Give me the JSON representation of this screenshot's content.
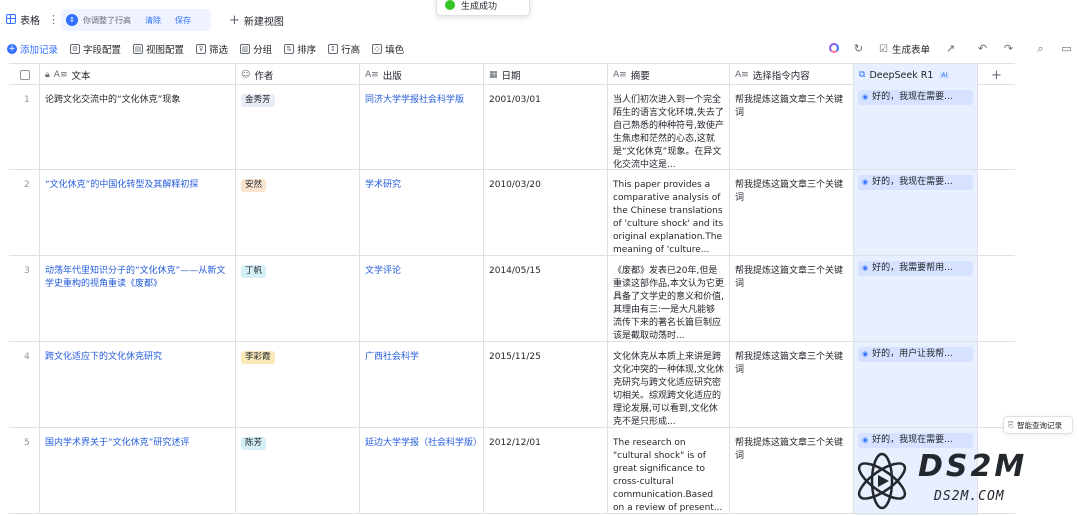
{
  "view_tab": {
    "label": "表格"
  },
  "notice": {
    "text": "你调整了行高",
    "clear": "清除",
    "save": "保存"
  },
  "new_view": "新建视图",
  "toast": "生成成功",
  "toolbar": {
    "add": "添加记录",
    "field_config": "字段配置",
    "view_config": "视图配置",
    "filter": "筛选",
    "group": "分组",
    "sort": "排序",
    "row_height": "行高",
    "fill_color": "填色",
    "generate_form": "生成表单"
  },
  "columns": [
    {
      "key": "text",
      "icon": "A≡",
      "label": "文本"
    },
    {
      "key": "author",
      "icon": "☺",
      "label": "作者"
    },
    {
      "key": "publisher",
      "icon": "A≡",
      "label": "出版"
    },
    {
      "key": "date",
      "icon": "▦",
      "label": "日期"
    },
    {
      "key": "summary",
      "icon": "A≡",
      "label": "摘要"
    },
    {
      "key": "prompt",
      "icon": "A≡",
      "label": "选择指令内容"
    },
    {
      "key": "deepseek",
      "icon": "⧉",
      "label": "DeepSeek R1",
      "badge": "AI"
    }
  ],
  "rows": [
    {
      "num": "1",
      "text": "论跨文化交流中的“文化休克”现象",
      "text_link": false,
      "author": "金秀芳",
      "author_color": "#e8edf5",
      "publisher": "同济大学学报社会科学版",
      "date": "2001/03/01",
      "summary": "当人们初次进入到一个完全陌生的语言文化环境,失去了自己熟悉的种种符号,致使产生焦虑和茫然的心态,这就是“文化休克”现象。在异文化交流中这是...",
      "prompt": "帮我提炼这篇文章三个关键词",
      "deepseek": "好的，我现在需要..."
    },
    {
      "num": "2",
      "text": "“文化休克”的中国化转型及其解释初探",
      "text_link": true,
      "author": "安然",
      "author_color": "#fbe4cf",
      "publisher": "学术研究",
      "date": "2010/03/20",
      "summary": "This paper provides a comparative analysis of the Chinese translations of 'culture shock' and its original explanation.The meaning of 'culture...",
      "prompt": "帮我提炼这篇文章三个关键词",
      "deepseek": "好的，我现在需要..."
    },
    {
      "num": "3",
      "text": "动荡年代里知识分子的“文化休克”——从新文学史重构的视角重读《废都》",
      "text_link": true,
      "author": "丁帆",
      "author_color": "#d5eff6",
      "publisher": "文学评论",
      "date": "2014/05/15",
      "summary": "《废都》发表已20年,但是重读这部作品,本文认为它更具备了文学史的意义和价值,其理由有三:一是大凡能够流传下来的著名长篇巨制应该是截取动荡时...",
      "prompt": "帮我提炼这篇文章三个关键词",
      "deepseek": "好的，我需要帮用..."
    },
    {
      "num": "4",
      "text": "跨文化适应下的文化休克研究",
      "text_link": true,
      "author": "李彩霞",
      "author_color": "#fae8b8",
      "publisher": "广西社会科学",
      "date": "2015/11/25",
      "summary": "文化休克从本质上来讲是跨文化冲突的一种体现,文化休克研究与跨文化适应研究密切相关。综观跨文化适应的理论发展,可以看到,文化休克不是只形成...",
      "prompt": "帮我提炼这篇文章三个关键词",
      "deepseek": "好的，用户让我帮..."
    },
    {
      "num": "5",
      "text": "国内学术界关于“文化休克”研究述评",
      "text_link": true,
      "author": "陈芳",
      "author_color": "#d5eff6",
      "publisher": "延边大学学报（社会科学版）",
      "date": "2012/12/01",
      "summary": "The research on \"cultural shock\" is of great significance to cross-cultural communication.Based on a review of present...",
      "prompt": "帮我提炼这篇文章三个关键词",
      "deepseek": "好的，我现在需要..."
    }
  ],
  "side": {
    "smart_query": "智能查询记录"
  },
  "watermark": {
    "big": "DS2M",
    "small": "DS2M.COM"
  },
  "colors": {
    "accent": "#3370ff",
    "link": "#245bdb",
    "ai_column": "#e8efff"
  }
}
